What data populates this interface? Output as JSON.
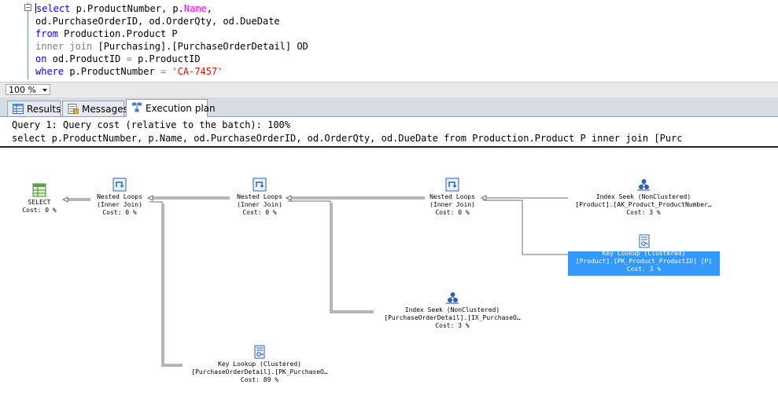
{
  "editor": {
    "lines": [
      {
        "parts": [
          [
            "kw",
            "select"
          ],
          [
            "txt",
            " p.ProductNumber, p."
          ],
          [
            "mg",
            "Name"
          ],
          [
            "txt",
            ","
          ]
        ]
      },
      {
        "parts": [
          [
            "txt",
            "od.PurchaseOrderID, od.OrderQty, od.DueDate"
          ]
        ]
      },
      {
        "parts": [
          [
            "kw",
            "from"
          ],
          [
            "txt",
            " Production.Product P"
          ]
        ]
      },
      {
        "parts": [
          [
            "gr",
            "inner join"
          ],
          [
            "txt",
            " [Purchasing].[PurchaseOrderDetail] OD"
          ]
        ]
      },
      {
        "parts": [
          [
            "kw",
            "on"
          ],
          [
            "txt",
            " od.ProductID "
          ],
          [
            "gr",
            "="
          ],
          [
            "txt",
            " p.ProductID"
          ]
        ]
      },
      {
        "parts": [
          [
            "kw",
            "where"
          ],
          [
            "txt",
            " p.ProductNumber "
          ],
          [
            "gr",
            "="
          ],
          [
            "txt",
            " "
          ],
          [
            "str",
            "'CA-7457'"
          ]
        ]
      }
    ]
  },
  "zoom": {
    "value": "100 %"
  },
  "tabs": [
    {
      "label": "Results",
      "icon": "grid-icon"
    },
    {
      "label": "Messages",
      "icon": "messages-icon"
    },
    {
      "label": "Execution plan",
      "icon": "execution-plan-icon"
    }
  ],
  "plan": {
    "header1": "Query 1: Query cost (relative to the batch): 100%",
    "header2": "select p.ProductNumber, p.Name, od.PurchaseOrderID, od.OrderQty, od.DueDate from Production.Product P inner join [Purc",
    "nodes": {
      "select": {
        "line1": "SELECT",
        "line2": "Cost: 0 %",
        "icon": "select-icon"
      },
      "nl1": {
        "line1": "Nested Loops",
        "line2": "(Inner Join)",
        "line3": "Cost: 0 %",
        "icon": "nested-loops-icon"
      },
      "nl2": {
        "line1": "Nested Loops",
        "line2": "(Inner Join)",
        "line3": "Cost: 0 %",
        "icon": "nested-loops-icon"
      },
      "nl3": {
        "line1": "Nested Loops",
        "line2": "(Inner Join)",
        "line3": "Cost: 0 %",
        "icon": "nested-loops-icon"
      },
      "seekProduct": {
        "line1": "Index Seek (NonClustered)",
        "line2": "[Product].[AK_Product_ProductNumber…",
        "line3": "Cost: 3 %",
        "icon": "index-seek-icon"
      },
      "lookupProduct": {
        "line1": "Key Lookup (Clustered)",
        "line2": "[Product].[PK_Product_ProductID] [P]",
        "line3": "Cost: 3 %",
        "icon": "key-lookup-icon"
      },
      "seekPOD": {
        "line1": "Index Seek (NonClustered)",
        "line2": "[PurchaseOrderDetail].[IX_PurchaseO…",
        "line3": "Cost: 3 %",
        "icon": "index-seek-icon"
      },
      "lookupPOD": {
        "line1": "Key Lookup (Clustered)",
        "line2": "[PurchaseOrderDetail].[PK_PurchaseO…",
        "line3": "Cost: 89 %",
        "icon": "key-lookup-icon"
      }
    }
  }
}
